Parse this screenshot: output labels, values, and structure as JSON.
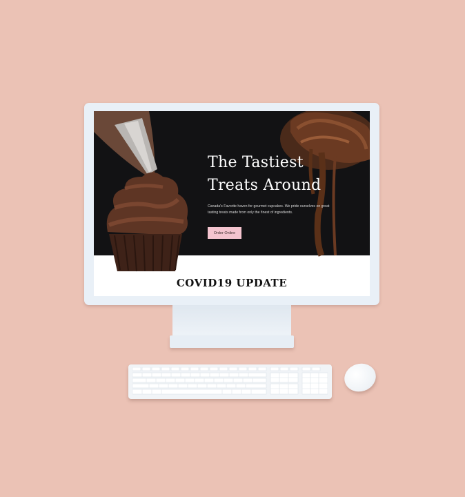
{
  "website": {
    "hero": {
      "title_line1": "The Tastiest",
      "title_line2": "Treats Around",
      "subtitle": "Canada's Favorite haven for gourmet cupcakes. We pride ourselves on great tasting treats made from only the finest of ingredients.",
      "order_button": "Order Online"
    },
    "covid_heading": "COVID19 UPDATE"
  },
  "colors": {
    "background": "#ebc2b5",
    "hero_background": "#121214",
    "button": "#f4c4cf"
  }
}
